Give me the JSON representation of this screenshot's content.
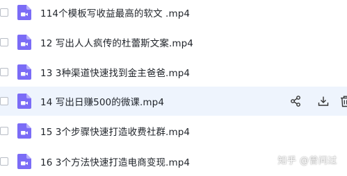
{
  "files": [
    {
      "name": "114个模板写收益最高的软文 .mp4",
      "icon": "video-file-icon"
    },
    {
      "name": "12 写出人人疯传的杜蕾斯文案.mp4",
      "icon": "video-file-icon"
    },
    {
      "name": "13 3种渠道快速找到金主爸爸.mp4",
      "icon": "video-file-icon"
    },
    {
      "name": "14 写出日赚500的微课.mp4",
      "icon": "video-file-icon"
    },
    {
      "name": "15 3个步骤快速打造收费社群.mp4",
      "icon": "video-file-icon"
    },
    {
      "name": "16 3个方法快速打造电商变现.mp4",
      "icon": "video-file-icon"
    }
  ],
  "hovered_row": 4,
  "row_actions": [
    "share-icon",
    "download-icon",
    "delete-icon"
  ],
  "watermark": "知乎 @曾问过",
  "colors": {
    "icon_purple": "#7b6cf6",
    "hover_bg": "#eef4fd",
    "text": "#1f2329",
    "action_icon": "#333333"
  }
}
